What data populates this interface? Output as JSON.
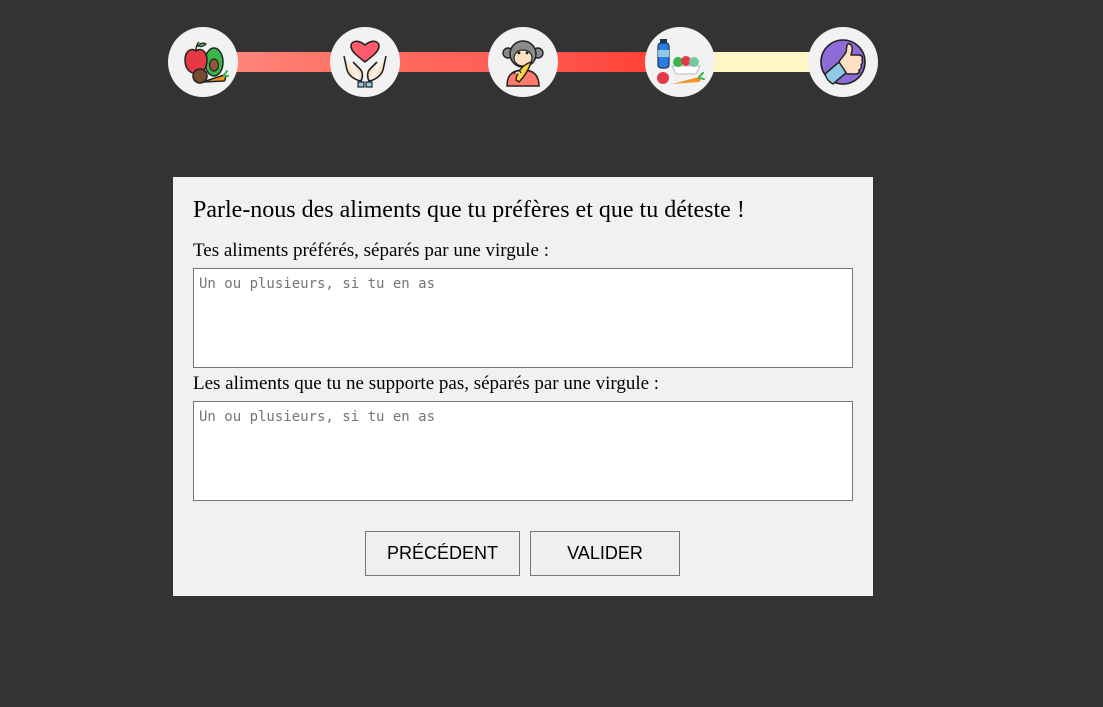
{
  "stepper": {
    "steps": [
      {
        "icon": "fruits-icon"
      },
      {
        "icon": "heart-hands-icon"
      },
      {
        "icon": "monkey-banana-icon"
      },
      {
        "icon": "healthy-food-icon"
      },
      {
        "icon": "thumbs-up-icon"
      }
    ],
    "colors": {
      "done": "#ff5a52",
      "pending": "#fff6c4",
      "circle": "#f2f2f2"
    }
  },
  "form": {
    "title": "Parle-nous des aliments que tu préfères et que tu déteste !",
    "liked": {
      "label": "Tes aliments préférés, séparés par une virgule :",
      "placeholder": "Un ou plusieurs, si tu en as",
      "value": ""
    },
    "disliked": {
      "label": "Les aliments que tu ne supporte pas, séparés par une virgule :",
      "placeholder": "Un ou plusieurs, si tu en as",
      "value": ""
    },
    "buttons": {
      "previous": "PRÉCÉDENT",
      "submit": "VALIDER"
    }
  }
}
